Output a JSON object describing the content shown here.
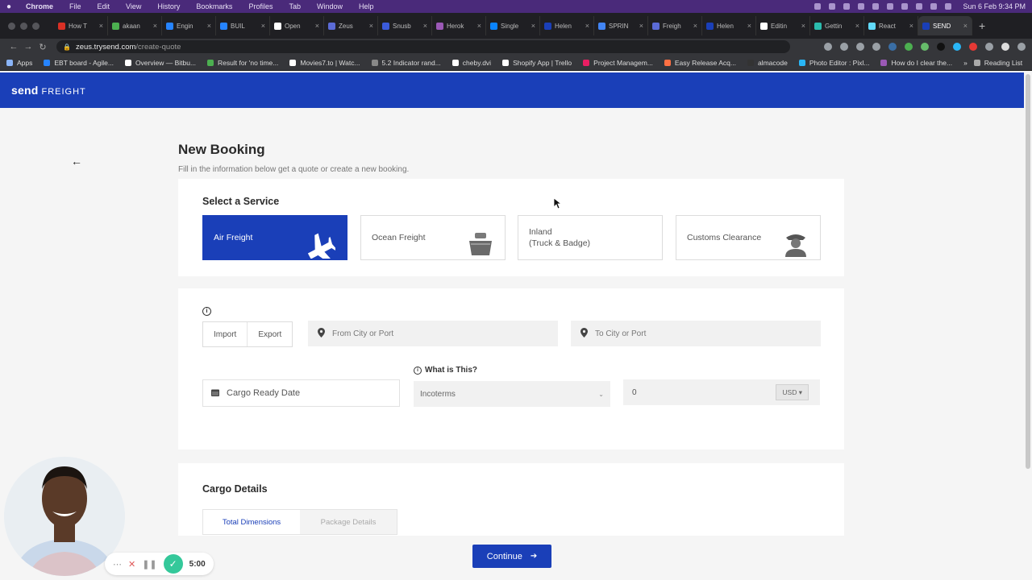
{
  "mac_menu": {
    "items": [
      "Chrome",
      "File",
      "Edit",
      "View",
      "History",
      "Bookmarks",
      "Profiles",
      "Tab",
      "Window",
      "Help"
    ],
    "clock": "Sun 6 Feb  9:34 PM"
  },
  "tabs": [
    {
      "title": "How T",
      "color": "#d93025"
    },
    {
      "title": "akaan",
      "color": "#4caf50"
    },
    {
      "title": "Engin",
      "color": "#2684ff"
    },
    {
      "title": "BUIL",
      "color": "#2684ff"
    },
    {
      "title": "Open",
      "color": "#ffffff"
    },
    {
      "title": "Zeus",
      "color": "#5b6bd6"
    },
    {
      "title": "Snusb",
      "color": "#3b5bdb"
    },
    {
      "title": "Herok",
      "color": "#9b59b6"
    },
    {
      "title": "Single",
      "color": "#0a84ff"
    },
    {
      "title": "Helen",
      "color": "#1a3fb8"
    },
    {
      "title": "SPRIN",
      "color": "#4285f4"
    },
    {
      "title": "Freigh",
      "color": "#5b6bd6"
    },
    {
      "title": "Helen",
      "color": "#1a3fb8"
    },
    {
      "title": "Editin",
      "color": "#ffffff"
    },
    {
      "title": "Gettin",
      "color": "#2bbbad"
    },
    {
      "title": "React",
      "color": "#61dafb"
    },
    {
      "title": "SEND",
      "color": "#1a3fb8",
      "active": true
    }
  ],
  "address_bar": {
    "host": "zeus.trysend.com",
    "path": "/create-quote"
  },
  "bookmarks": {
    "items": [
      {
        "label": "Apps",
        "color": "#8ab4f8"
      },
      {
        "label": "EBT board - Agile...",
        "color": "#2684ff"
      },
      {
        "label": "Overview — Bitbu...",
        "color": "#ffffff"
      },
      {
        "label": "Result for 'no time...",
        "color": "#4caf50"
      },
      {
        "label": "Movies7.to | Watc...",
        "color": "#ffffff"
      },
      {
        "label": "5.2 Indicator rand...",
        "color": "#888888"
      },
      {
        "label": "cheby.dvi",
        "color": "#ffffff"
      },
      {
        "label": "Shopify App | Trello",
        "color": "#ffffff"
      },
      {
        "label": "Project Managem...",
        "color": "#e91e63"
      },
      {
        "label": "Easy Release Acq...",
        "color": "#ff7043"
      },
      {
        "label": "almacode",
        "color": "#333333"
      },
      {
        "label": "Photo Editor : Pixl...",
        "color": "#29b6f6"
      },
      {
        "label": "How do I clear the...",
        "color": "#9b59b6"
      }
    ],
    "reading_list": "Reading List"
  },
  "app": {
    "logo_main": "send",
    "logo_sub": "FREIGHT"
  },
  "page": {
    "title": "New Booking",
    "subtitle": "Fill in the information below get a quote or create a new booking."
  },
  "service_section": {
    "title": "Select a Service",
    "options": [
      {
        "label": "Air Freight",
        "icon": "airplane-icon",
        "selected": true
      },
      {
        "label": "Ocean Freight",
        "icon": "ship-icon",
        "selected": false
      },
      {
        "label_line1": "Inland",
        "label_line2": "(Truck & Badge)",
        "selected": false
      },
      {
        "label": "Customs Clearance",
        "icon": "officer-icon",
        "selected": false
      }
    ]
  },
  "route_section": {
    "import_label": "Import",
    "export_label": "Export",
    "from_placeholder": "From City or Port",
    "to_placeholder": "To City or Port",
    "cargo_ready_placeholder": "Cargo Ready Date",
    "what_is_this": "What is This?",
    "incoterms_placeholder": "Incoterms",
    "amount_value": "0",
    "currency": "USD"
  },
  "cargo_section": {
    "title": "Cargo Details",
    "tabs": [
      {
        "label": "Total Dimensions",
        "active": true
      },
      {
        "label": "Package Details",
        "active": false
      }
    ]
  },
  "continue_label": "Continue",
  "recorder": {
    "timer": "5:00"
  },
  "colors": {
    "brand": "#1a3fb8",
    "recorder_done": "#34c89a"
  }
}
